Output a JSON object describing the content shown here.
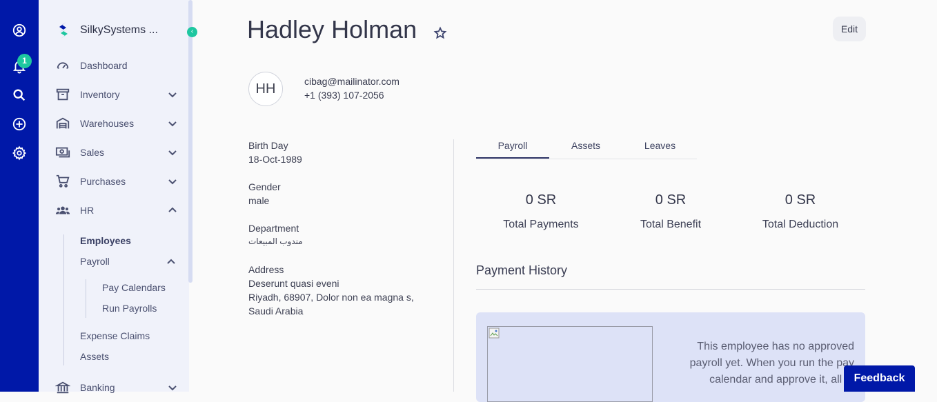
{
  "brand": {
    "name": "SilkySystems ...",
    "accent": "#0018a8",
    "highlight": "#1ec7a0"
  },
  "rail": {
    "items": [
      {
        "icon": "account-circle-icon"
      },
      {
        "icon": "bell-icon",
        "badge": "1"
      },
      {
        "icon": "search-icon"
      },
      {
        "icon": "add-circle-icon"
      },
      {
        "icon": "gear-icon"
      }
    ]
  },
  "sidebar": {
    "items": [
      {
        "label": "Dashboard",
        "icon": "speedometer-icon"
      },
      {
        "label": "Inventory",
        "icon": "archive-icon"
      },
      {
        "label": "Warehouses",
        "icon": "warehouse-icon"
      },
      {
        "label": "Sales",
        "icon": "cash-icon"
      },
      {
        "label": "Purchases",
        "icon": "cart-icon"
      },
      {
        "label": "HR",
        "icon": "people-icon"
      },
      {
        "label": "Banking",
        "icon": "bank-icon"
      }
    ],
    "hr_children": {
      "employees": "Employees",
      "payroll": "Payroll",
      "pay_calendars": "Pay Calendars",
      "run_payrolls": "Run Payrolls",
      "expense_claims": "Expense Claims",
      "assets": "Assets"
    }
  },
  "employee": {
    "name": "Hadley Holman",
    "initials": "HH",
    "email": "cibag@mailinator.com",
    "phone": "+1 (393) 107-2056",
    "edit_label": "Edit",
    "fields": {
      "birthday_label": "Birth Day",
      "birthday": "18-Oct-1989",
      "gender_label": "Gender",
      "gender": "male",
      "department_label": "Department",
      "department": "مندوب المبيعات",
      "address_label": "Address",
      "address_line1": "Deserunt quasi eveni",
      "address_line2": "Riyadh, 68907, Dolor non ea magna s,",
      "address_line3": "Saudi Arabia"
    }
  },
  "tabs": [
    "Payroll",
    "Assets",
    "Leaves"
  ],
  "stats": [
    {
      "value": "0 SR",
      "label": "Total Payments"
    },
    {
      "value": "0 SR",
      "label": "Total Benefit"
    },
    {
      "value": "0 SR",
      "label": "Total Deduction"
    }
  ],
  "payment_history": {
    "title": "Payment History",
    "empty_text": "This employee has no approved payroll yet. When you run the pay calendar and approve it, all th"
  },
  "feedback_label": "Feedback"
}
